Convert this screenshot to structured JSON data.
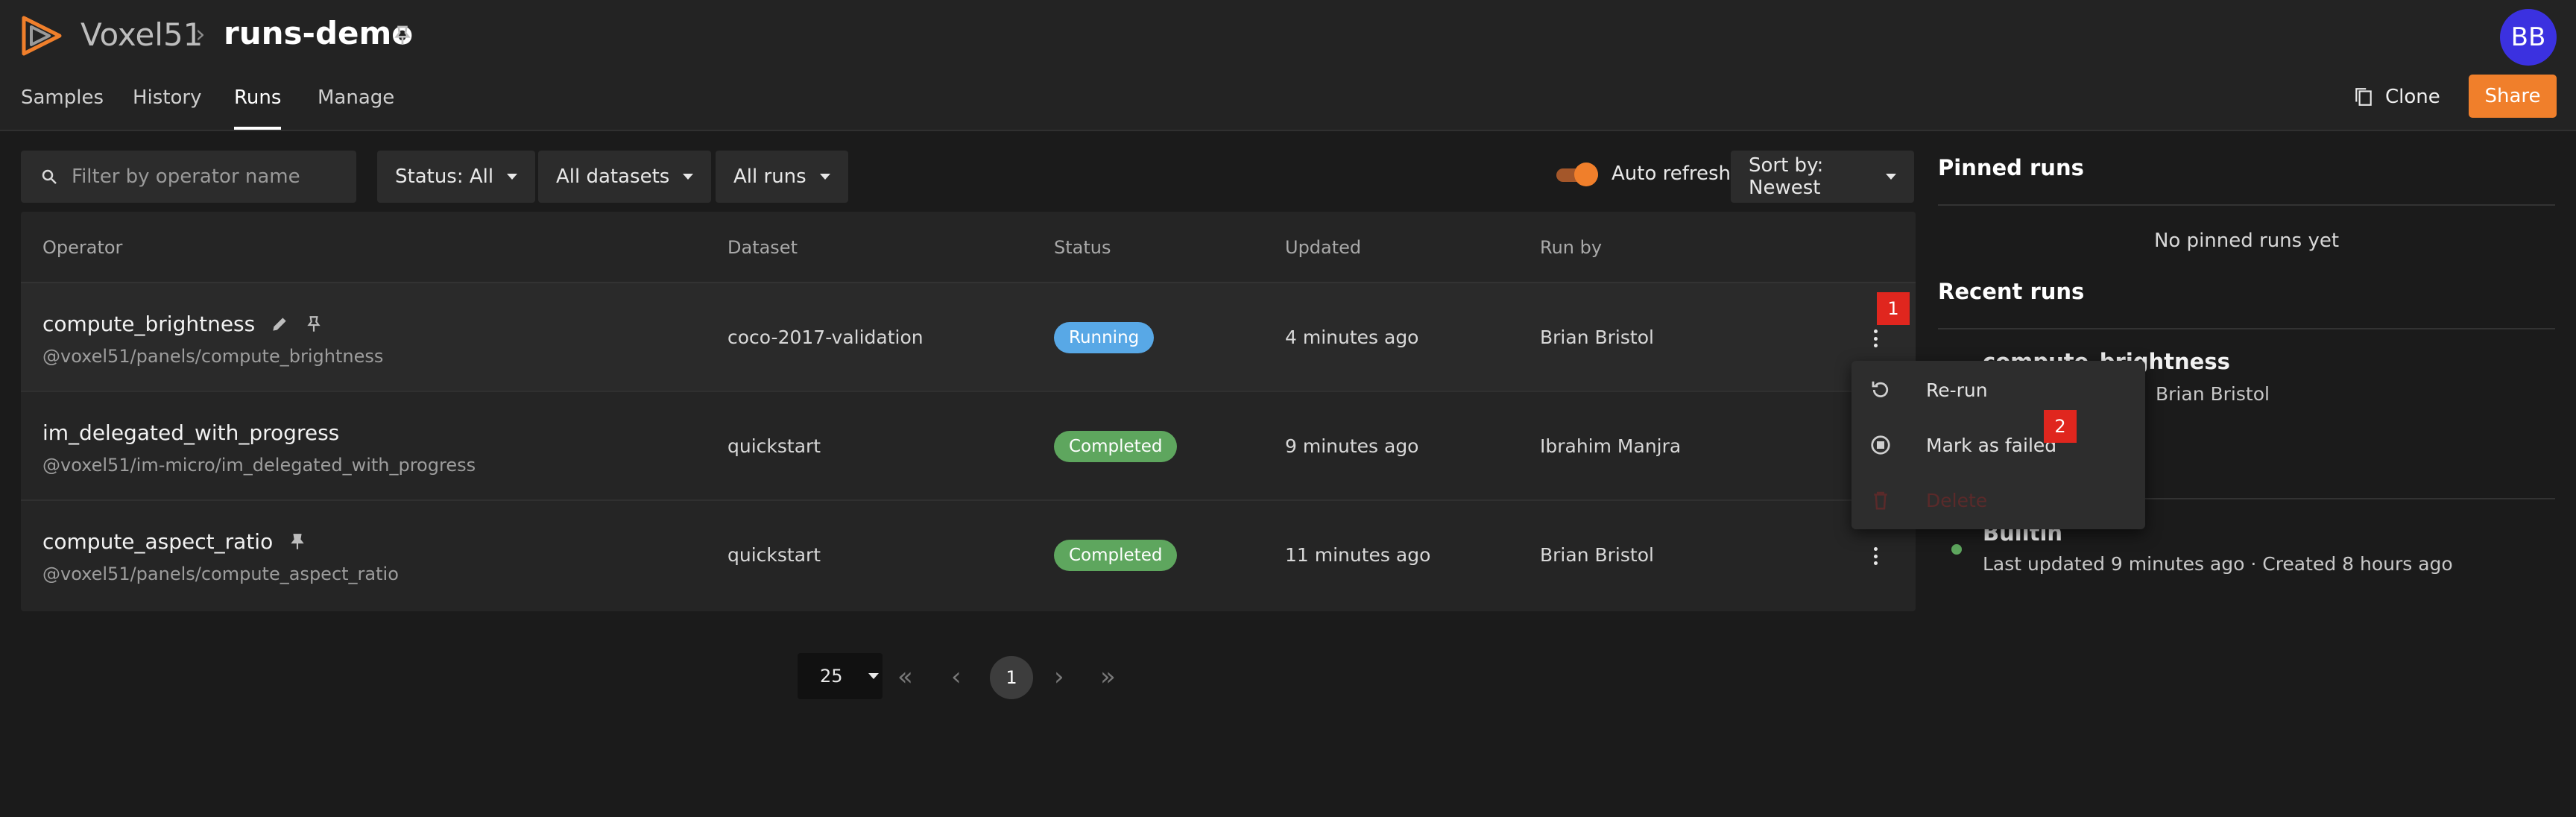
{
  "header": {
    "brand": "Voxel51",
    "separator": "›",
    "dataset_name": "runs-demo",
    "avatar_initials": "BB",
    "tabs": [
      {
        "label": "Samples"
      },
      {
        "label": "History"
      },
      {
        "label": "Runs",
        "active": true
      },
      {
        "label": "Manage"
      }
    ],
    "clone_label": "Clone",
    "share_label": "Share"
  },
  "toolbar": {
    "filter_placeholder": "Filter by operator name",
    "status_filter": "Status: All",
    "dataset_filter": "All datasets",
    "runs_filter": "All runs",
    "auto_refresh_label": "Auto refresh",
    "auto_refresh_on": true,
    "sort_label": "Sort by: Newest"
  },
  "table": {
    "columns": [
      "Operator",
      "Dataset",
      "Status",
      "Updated",
      "Run by"
    ],
    "rows": [
      {
        "operator": "compute_brightness",
        "uri": "@voxel51/panels/compute_brightness",
        "dataset": "coco-2017-validation",
        "status": "Running",
        "updated": "4 minutes ago",
        "run_by": "Brian Bristol"
      },
      {
        "operator": "im_delegated_with_progress",
        "uri": "@voxel51/im-micro/im_delegated_with_progress",
        "dataset": "quickstart",
        "status": "Completed",
        "updated": "9 minutes ago",
        "run_by": "Ibrahim Manjra"
      },
      {
        "operator": "compute_aspect_ratio",
        "uri": "@voxel51/panels/compute_aspect_ratio",
        "dataset": "quickstart",
        "status": "Completed",
        "updated": "11 minutes ago",
        "run_by": "Brian Bristol"
      }
    ]
  },
  "context_menu": {
    "items": [
      {
        "label": "Re-run"
      },
      {
        "label": "Mark as failed"
      },
      {
        "label": "Delete",
        "disabled": true
      }
    ]
  },
  "markers": [
    "1",
    "2"
  ],
  "right_panel": {
    "pinned_title": "Pinned runs",
    "no_pinned": "No pinned runs yet",
    "recent_title": "Recent runs",
    "recent": [
      {
        "title": "compute_brightness",
        "meta": "Brian Bristol"
      },
      {
        "title": "Builtin",
        "meta": "Last updated 9 minutes ago  ·  Created 8 hours ago"
      }
    ]
  },
  "pagination": {
    "page_size": "25",
    "current_page": "1"
  },
  "colors": {
    "accent": "#f07f2b",
    "running": "#58a8e6",
    "completed": "#5ea65e",
    "marker": "#e0261e",
    "avatar": "#3b31e0"
  }
}
